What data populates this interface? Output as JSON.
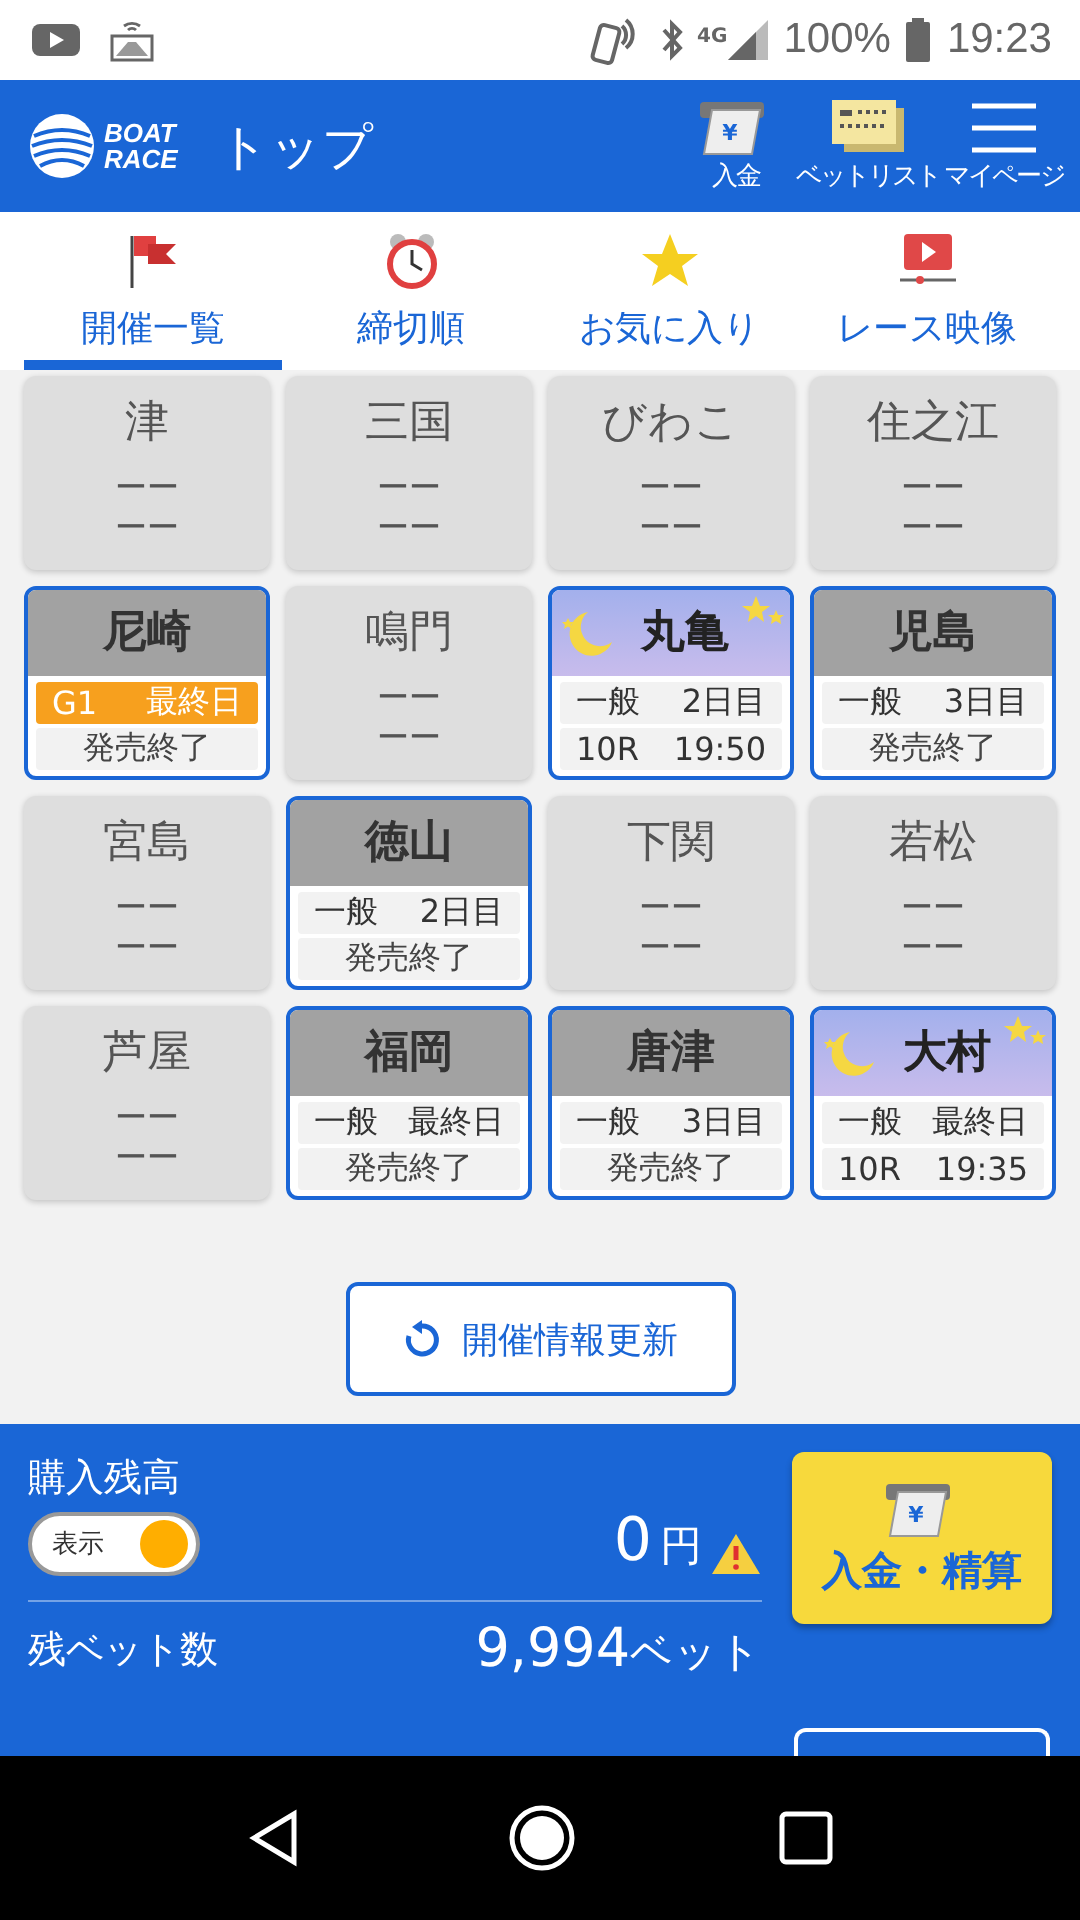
{
  "status_bar": {
    "network": "4G",
    "battery": "100%",
    "time": "19:23"
  },
  "header": {
    "logo_line1": "BOAT",
    "logo_line2": "RACE",
    "title": "トップ",
    "actions": [
      {
        "kind": "deposit",
        "label": "入金",
        "symbol": "¥"
      },
      {
        "kind": "betlist",
        "label": "ベットリスト"
      },
      {
        "kind": "menu",
        "label": "マイページ"
      }
    ]
  },
  "tabs": [
    {
      "kind": "flag",
      "label": "開催一覧",
      "selected": true
    },
    {
      "kind": "clock",
      "label": "締切順",
      "selected": false
    },
    {
      "kind": "star",
      "label": "お気に入り",
      "selected": false
    },
    {
      "kind": "video",
      "label": "レース映像",
      "selected": false
    }
  ],
  "venues": [
    {
      "name": "津",
      "kind": "closed",
      "line1": [
        "ーー"
      ],
      "line2": [
        "ーー"
      ]
    },
    {
      "name": "三国",
      "kind": "closed",
      "line1": [
        "ーー"
      ],
      "line2": [
        "ーー"
      ]
    },
    {
      "name": "びわこ",
      "kind": "closed",
      "line1": [
        "ーー"
      ],
      "line2": [
        "ーー"
      ]
    },
    {
      "name": "住之江",
      "kind": "closed",
      "line1": [
        "ーー"
      ],
      "line2": [
        "ーー"
      ]
    },
    {
      "name": "尼崎",
      "kind": "finished",
      "highlight": true,
      "line1": [
        "G1",
        "最終日"
      ],
      "line2": [
        "発売終了"
      ]
    },
    {
      "name": "鳴門",
      "kind": "closed",
      "line1": [
        "ーー"
      ],
      "line2": [
        "ーー"
      ]
    },
    {
      "name": "丸亀",
      "kind": "night",
      "highlight": false,
      "line1": [
        "一般",
        "2日目"
      ],
      "line2": [
        "10R",
        "19:50"
      ]
    },
    {
      "name": "児島",
      "kind": "finished",
      "highlight": false,
      "line1": [
        "一般",
        "3日目"
      ],
      "line2": [
        "発売終了"
      ]
    },
    {
      "name": "宮島",
      "kind": "closed",
      "line1": [
        "ーー"
      ],
      "line2": [
        "ーー"
      ]
    },
    {
      "name": "徳山",
      "kind": "finished",
      "highlight": false,
      "line1": [
        "一般",
        "2日目"
      ],
      "line2": [
        "発売終了"
      ]
    },
    {
      "name": "下関",
      "kind": "closed",
      "line1": [
        "ーー"
      ],
      "line2": [
        "ーー"
      ]
    },
    {
      "name": "若松",
      "kind": "closed",
      "line1": [
        "ーー"
      ],
      "line2": [
        "ーー"
      ]
    },
    {
      "name": "芦屋",
      "kind": "closed",
      "line1": [
        "ーー"
      ],
      "line2": [
        "ーー"
      ]
    },
    {
      "name": "福岡",
      "kind": "finished",
      "highlight": false,
      "line1": [
        "一般",
        "最終日"
      ],
      "line2": [
        "発売終了"
      ]
    },
    {
      "name": "唐津",
      "kind": "finished",
      "highlight": false,
      "line1": [
        "一般",
        "3日目"
      ],
      "line2": [
        "発売終了"
      ]
    },
    {
      "name": "大村",
      "kind": "night",
      "highlight": false,
      "line1": [
        "一般",
        "最終日"
      ],
      "line2": [
        "10R",
        "19:35"
      ]
    }
  ],
  "refresh_button": "開催情報更新",
  "balance": {
    "label": "購入残高",
    "toggle": {
      "label": "表示",
      "on": true
    },
    "amount": "0",
    "unit": "円",
    "warning": true,
    "bets_label": "残ベット数",
    "bets_value": "9,994",
    "bets_unit": "ベット",
    "deposit_symbol": "¥",
    "deposit_button": "入金・精算"
  }
}
